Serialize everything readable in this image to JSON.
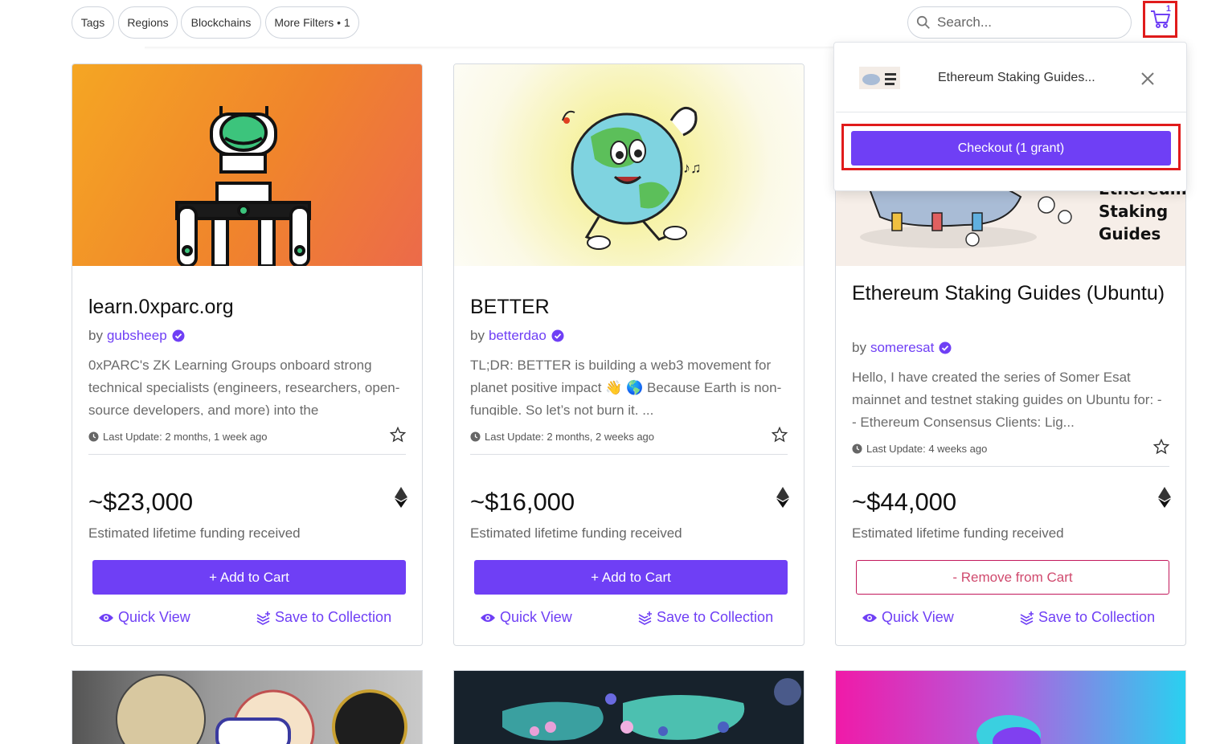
{
  "filters": [
    "Tags",
    "Regions",
    "Blockchains",
    "More Filters • 1"
  ],
  "search": {
    "placeholder": "Search..."
  },
  "cart": {
    "count": "1",
    "item_name": "Ethereum Staking Guides...",
    "checkout_label": "Checkout (1 grant)"
  },
  "colors": {
    "accent": "#6f3ff5",
    "remove": "#d04a6e",
    "highlight": "#e01b1b"
  },
  "cards": [
    {
      "title": "learn.0xparc.org",
      "by": "by",
      "owner": "gubsheep",
      "description": "0xPARC's ZK Learning Groups onboard strong technical specialists (engineers, researchers, open-source developers, and more) into the",
      "last_update": "Last Update: 2 months, 1 week ago",
      "amount": "~$23,000",
      "estimate_label": "Estimated lifetime funding received",
      "action_label": "+ Add to Cart",
      "quick_view": "Quick View",
      "save": "Save to Collection"
    },
    {
      "title": "BETTER",
      "by": "by",
      "owner": "betterdao",
      "description": "TL;DR: BETTER is building a web3 movement for planet positive impact 👋 🌎 Because Earth is non-fungible. So let’s not burn it.   ...",
      "last_update": "Last Update: 2 months, 2 weeks ago",
      "amount": "~$16,000",
      "estimate_label": "Estimated lifetime funding received",
      "action_label": "+ Add to Cart",
      "quick_view": "Quick View",
      "save": "Save to Collection"
    },
    {
      "title": "Ethereum Staking Guides (Ubuntu)",
      "by": "by",
      "owner": "someresat",
      "description": "Hello, I have created the series of Somer Esat mainnet and testnet staking guides on Ubuntu for: -- Ethereum Consensus Clients: Lig...",
      "last_update": "Last Update: 4 weeks ago",
      "amount": "~$44,000",
      "estimate_label": "Estimated lifetime funding received",
      "action_label": "- Remove from Cart",
      "quick_view": "Quick View",
      "save": "Save to Collection",
      "banner_text": [
        "Ethereum",
        "Staking",
        "Guides"
      ]
    }
  ]
}
